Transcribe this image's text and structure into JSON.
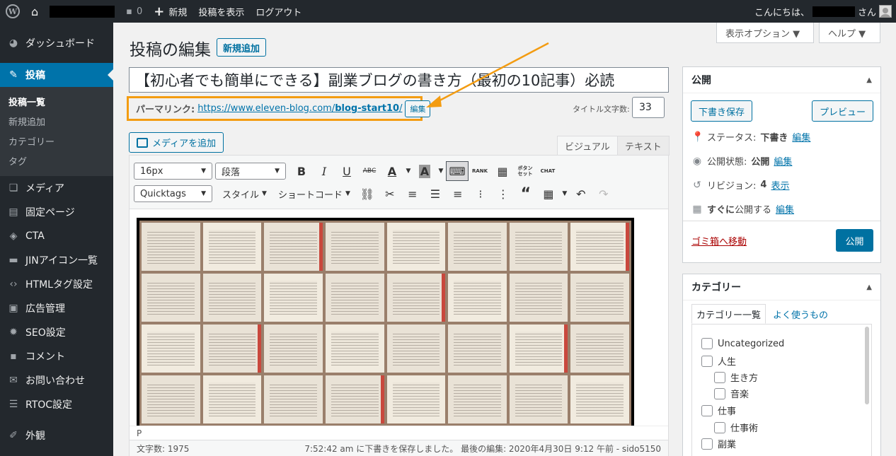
{
  "adminbar": {
    "comments_count": "0",
    "new_label": "新規",
    "view_post": "投稿を表示",
    "logout": "ログアウト",
    "greeting_prefix": "こんにちは、",
    "greeting_suffix": "さん"
  },
  "sidebar": {
    "items": [
      {
        "label": "ダッシュボード",
        "icon": "dashboard-icon"
      },
      {
        "label": "投稿",
        "icon": "pin-icon"
      },
      {
        "label": "メディア",
        "icon": "media-icon"
      },
      {
        "label": "固定ページ",
        "icon": "page-icon"
      },
      {
        "label": "CTA",
        "icon": "tag-icon"
      },
      {
        "label": "JINアイコン一覧",
        "icon": "list-icon"
      },
      {
        "label": "HTMLタグ設定",
        "icon": "code-icon"
      },
      {
        "label": "広告管理",
        "icon": "ad-icon"
      },
      {
        "label": "SEO設定",
        "icon": "gear-icon"
      },
      {
        "label": "コメント",
        "icon": "comment-icon"
      },
      {
        "label": "お問い合わせ",
        "icon": "mail-icon"
      },
      {
        "label": "RTOC設定",
        "icon": "toc-icon"
      },
      {
        "label": "外観",
        "icon": "brush-icon"
      }
    ],
    "submenu": [
      "投稿一覧",
      "新規追加",
      "カテゴリー",
      "タグ"
    ]
  },
  "header": {
    "page_title": "投稿の編集",
    "add_new": "新規追加",
    "screen_options": "表示オプション ▼",
    "help": "ヘルプ ▼"
  },
  "post": {
    "title": "【初心者でも簡単にできる】副業ブログの書き方（最初の10記事）必読",
    "permalink_label": "パーマリンク:",
    "permalink_base": "https://www.eleven-blog.com/",
    "permalink_slug": "blog-start10",
    "permalink_trail": "/",
    "permalink_edit": "編集",
    "title_count_label": "タイトル文字数:",
    "title_count": "33"
  },
  "editor": {
    "add_media": "メディアを追加",
    "tab_visual": "ビジュアル",
    "tab_text": "テキスト",
    "font_size": "16px",
    "format": "段落",
    "quicktags": "Quicktags",
    "style": "スタイル",
    "shortcode": "ショートコード",
    "btn_rank": "RANK",
    "btn_button": "ボタン セット",
    "btn_chat": "CHAT",
    "path": "P",
    "word_count": "文字数: 1975",
    "save_status": "7:52:42 am に下書きを保存しました。 最後の編集: 2020年4月30日 9:12 午前 - sido5150"
  },
  "publish": {
    "title": "公開",
    "save_draft": "下書き保存",
    "preview": "プレビュー",
    "status_label": "ステータス:",
    "status_value": "下書き",
    "visibility_label": "公開状態:",
    "visibility_value": "公開",
    "revisions_label": "リビジョン:",
    "revisions_value": "4",
    "revisions_link": "表示",
    "schedule_strong": "すぐに",
    "schedule_rest": "公開する",
    "edit": "編集",
    "trash": "ゴミ箱へ移動",
    "publish": "公開"
  },
  "categories": {
    "title": "カテゴリー",
    "tab_all": "カテゴリー一覧",
    "tab_popular": "よく使うもの",
    "items": [
      {
        "label": "Uncategorized",
        "level": 0
      },
      {
        "label": "人生",
        "level": 0
      },
      {
        "label": "生き方",
        "level": 1
      },
      {
        "label": "音楽",
        "level": 1
      },
      {
        "label": "仕事",
        "level": 0
      },
      {
        "label": "仕事術",
        "level": 1
      },
      {
        "label": "副業",
        "level": 0
      }
    ]
  },
  "colors": {
    "accent": "#0073aa",
    "highlight": "#f39c12",
    "sidebar": "#23282d"
  }
}
